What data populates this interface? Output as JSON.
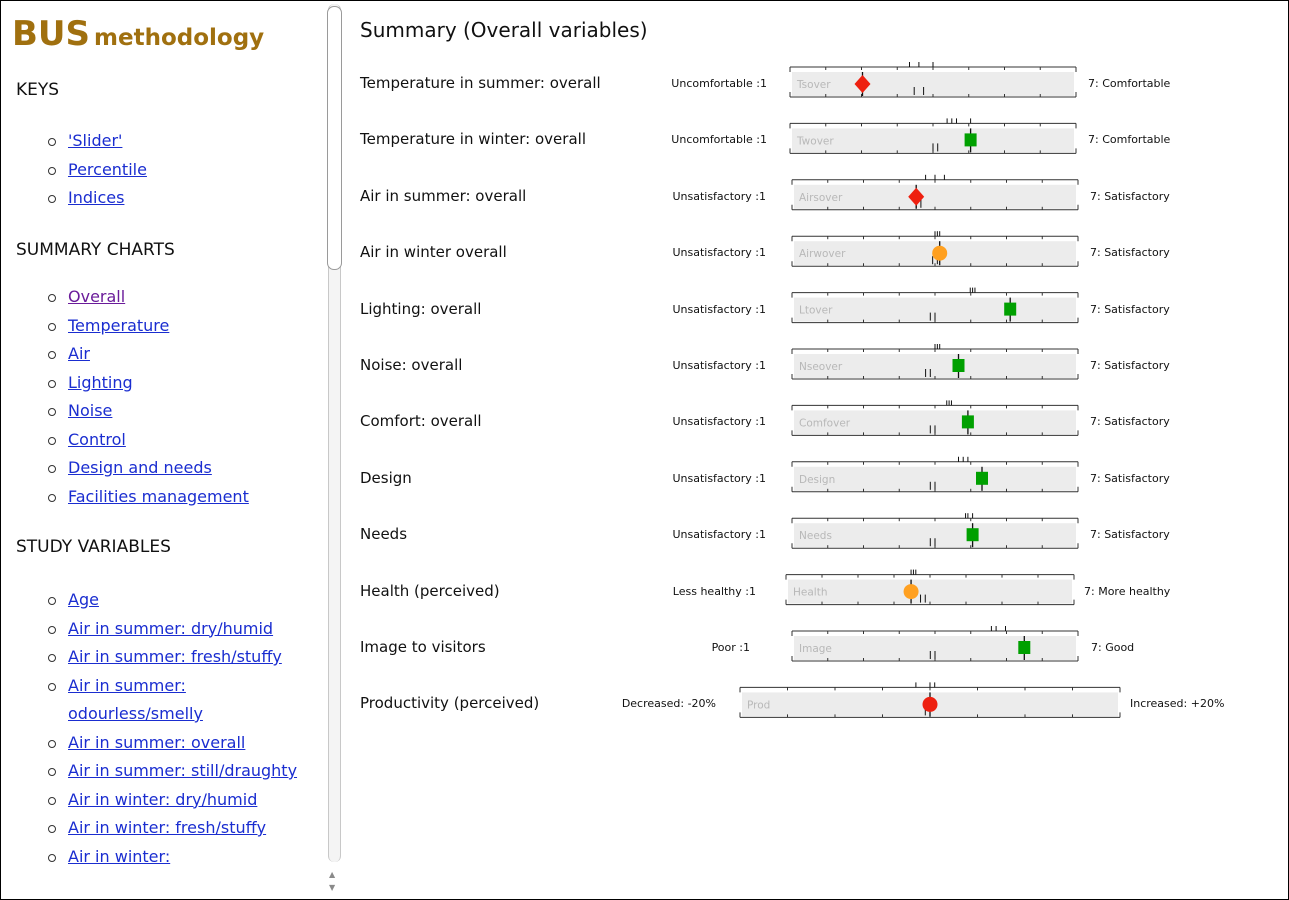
{
  "sidebar": {
    "brand_big": "BUS",
    "brand_small": "methodology",
    "sections": [
      {
        "heading": "KEYS",
        "items": [
          {
            "label": "'Slider'"
          },
          {
            "label": "Percentile"
          },
          {
            "label": "Indices"
          }
        ]
      },
      {
        "heading": "SUMMARY CHARTS",
        "items": [
          {
            "label": "Overall",
            "visited": true
          },
          {
            "label": "Temperature"
          },
          {
            "label": "Air"
          },
          {
            "label": "Lighting"
          },
          {
            "label": "Noise"
          },
          {
            "label": "Control"
          },
          {
            "label": "Design and needs"
          },
          {
            "label": "Facilities management"
          }
        ]
      },
      {
        "heading": "STUDY VARIABLES",
        "items": [
          {
            "label": "Age"
          },
          {
            "label": "Air in summer: dry/humid"
          },
          {
            "label": "Air in summer: fresh/stuffy"
          },
          {
            "label": "Air in summer: odourless/smelly"
          },
          {
            "label": "Air in summer: overall"
          },
          {
            "label": "Air in summer: still/draughty"
          },
          {
            "label": "Air in winter: dry/humid"
          },
          {
            "label": "Air in winter: fresh/stuffy"
          },
          {
            "label": "Air in winter:"
          }
        ]
      }
    ]
  },
  "main": {
    "title": "Summary (Overall variables)"
  },
  "chart_data": {
    "type": "scatter",
    "title": "Summary (Overall variables)",
    "marker_legend_colors": {
      "green_square": "#00a000",
      "amber_circle": "#ffa020",
      "red_diamond": "#ee2010",
      "red_circle": "#ee2010"
    },
    "rows": [
      {
        "label": "Temperature in summer: overall",
        "code": "Tsover",
        "left": "Uncomfortable :1",
        "right": "7: Comfortable",
        "min": 1,
        "max": 7,
        "value": 2.5,
        "marker": "diamond",
        "color": "#ee2010",
        "top_ticks": [
          3.5,
          3.7,
          4.0
        ],
        "bottom_ticks": [
          3.6,
          3.8
        ]
      },
      {
        "label": "Temperature in winter: overall",
        "code": "Twover",
        "left": "Uncomfortable :1",
        "right": "7: Comfortable",
        "min": 1,
        "max": 7,
        "value": 4.8,
        "marker": "square",
        "color": "#00a000",
        "top_ticks": [
          4.3,
          4.4,
          4.5,
          4.8
        ],
        "bottom_ticks": [
          4.0,
          4.1
        ]
      },
      {
        "label": "Air in summer: overall",
        "code": "Airsover",
        "left": "Unsatisfactory :1",
        "right": "7: Satisfactory",
        "min": 1,
        "max": 7,
        "value": 3.6,
        "marker": "diamond",
        "color": "#ee2010",
        "top_ticks": [
          3.8,
          4.0,
          4.2
        ],
        "bottom_ticks": [
          3.6,
          3.7
        ]
      },
      {
        "label": "Air in winter overall",
        "code": "Airwover",
        "left": "Unsatisfactory :1",
        "right": "7: Satisfactory",
        "min": 1,
        "max": 7,
        "value": 4.1,
        "marker": "circle",
        "color": "#ffa020",
        "top_ticks": [
          4.0,
          4.05,
          4.1
        ],
        "bottom_ticks": [
          3.95,
          4.05
        ]
      },
      {
        "label": "Lighting: overall",
        "code": "Ltover",
        "left": "Unsatisfactory :1",
        "right": "7: Satisfactory",
        "min": 1,
        "max": 7,
        "value": 5.6,
        "marker": "square",
        "color": "#00a000",
        "top_ticks": [
          4.75,
          4.8,
          4.85
        ],
        "bottom_ticks": [
          3.9,
          4.0
        ]
      },
      {
        "label": "Noise: overall",
        "code": "Nseover",
        "left": "Unsatisfactory :1",
        "right": "7: Satisfactory",
        "min": 1,
        "max": 7,
        "value": 4.5,
        "marker": "square",
        "color": "#00a000",
        "top_ticks": [
          4.0,
          4.05,
          4.1
        ],
        "bottom_ticks": [
          3.8,
          3.9
        ]
      },
      {
        "label": "Comfort: overall",
        "code": "Comfover",
        "left": "Unsatisfactory :1",
        "right": "7: Satisfactory",
        "min": 1,
        "max": 7,
        "value": 4.7,
        "marker": "square",
        "color": "#00a000",
        "top_ticks": [
          4.25,
          4.3,
          4.35
        ],
        "bottom_ticks": [
          3.9,
          4.0
        ]
      },
      {
        "label": "Design",
        "code": "Design",
        "left": "Unsatisfactory :1",
        "right": "7: Satisfactory",
        "min": 1,
        "max": 7,
        "value": 5.0,
        "marker": "square",
        "color": "#00a000",
        "top_ticks": [
          4.5,
          4.6,
          4.7
        ],
        "bottom_ticks": [
          3.9,
          4.0
        ]
      },
      {
        "label": "Needs",
        "code": "Needs",
        "left": "Unsatisfactory :1",
        "right": "7: Satisfactory",
        "min": 1,
        "max": 7,
        "value": 4.8,
        "marker": "square",
        "color": "#00a000",
        "top_ticks": [
          4.65,
          4.7,
          4.8
        ],
        "bottom_ticks": [
          3.9,
          4.0
        ]
      },
      {
        "label": "Health (perceived)",
        "code": "Health",
        "left": "Less healthy :1",
        "right": "7: More healthy",
        "min": 1,
        "max": 7,
        "value": 3.6,
        "marker": "circle",
        "color": "#ffa020",
        "top_ticks": [
          3.6,
          3.65,
          3.7
        ],
        "bottom_ticks": [
          3.8,
          3.9
        ]
      },
      {
        "label": "Image to visitors",
        "code": "Image",
        "left": "Poor :1",
        "right": "7: Good",
        "min": 1,
        "max": 7,
        "value": 5.9,
        "marker": "square",
        "color": "#00a000",
        "top_ticks": [
          5.2,
          5.3,
          5.5
        ],
        "bottom_ticks": [
          3.9,
          4.0
        ]
      },
      {
        "label": "Productivity (perceived)",
        "code": "Prod",
        "left": "Decreased: -20%",
        "right": "Increased: +20%",
        "min": -20,
        "max": 20,
        "value": 0.0,
        "marker": "circle",
        "color": "#ee2010",
        "top_ticks": [
          -1.5,
          0.0,
          0.5
        ],
        "bottom_ticks": [
          -0.5,
          0.0
        ]
      }
    ]
  }
}
